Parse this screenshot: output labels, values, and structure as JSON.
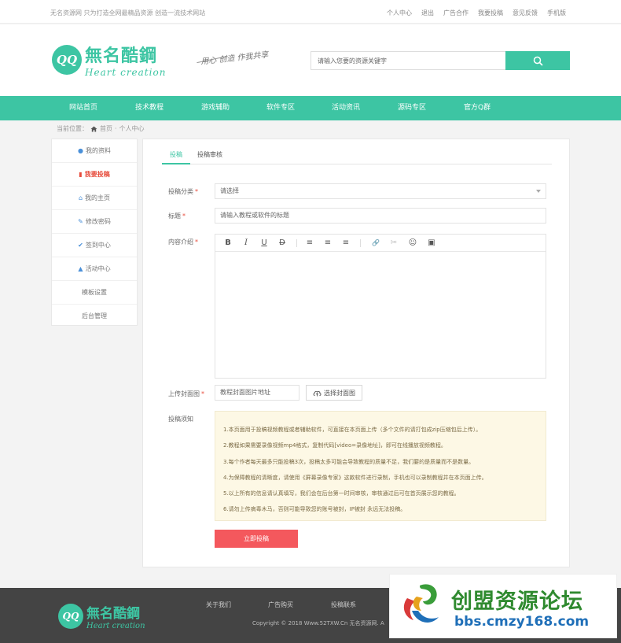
{
  "topbar": {
    "slogan": "无名资源网 只为打造全网最精品资源 创造一流技术网站",
    "links": [
      "个人中心",
      "退出",
      "广告合作",
      "我要投稿",
      "意见反馈",
      "手机版"
    ]
  },
  "header": {
    "logo_mark": "QQ",
    "logo_cn": "無名酷鋼",
    "logo_en": "Heart creation",
    "motto": "用心 创造 作我共享",
    "search_placeholder": "请输入您要的资源关键字"
  },
  "nav": [
    "网站首页",
    "技术教程",
    "游戏辅助",
    "软件专区",
    "活动资讯",
    "源码专区",
    "官方Q群"
  ],
  "breadcrumb": {
    "prefix": "当前位置：",
    "home": "首页",
    "sep": "·",
    "current": "个人中心"
  },
  "sidebar": [
    {
      "icon": "user-icon",
      "label": "我的资料"
    },
    {
      "icon": "file-icon",
      "label": "我要投稿"
    },
    {
      "icon": "home-icon",
      "label": "我的主页"
    },
    {
      "icon": "pencil-icon",
      "label": "修改密码"
    },
    {
      "icon": "signin-icon",
      "label": "签到中心"
    },
    {
      "icon": "fire-icon",
      "label": "活动中心"
    },
    {
      "icon": "",
      "label": "模板设置"
    },
    {
      "icon": "",
      "label": "后台管理"
    }
  ],
  "sidebar_active_index": 1,
  "tabs": [
    "投稿",
    "投稿审核"
  ],
  "form": {
    "category_label": "投稿分类",
    "category_value": "请选择",
    "title_label": "标题",
    "title_placeholder": "请输入教程或软件的标题",
    "content_label": "内容介绍",
    "cover_label": "上传封面图",
    "cover_placeholder": "教程封面图片地址",
    "cover_button": "选择封面图",
    "notice_label": "投稿须知",
    "required_mark": "*",
    "submit": "立即投稿"
  },
  "editor_toolbar": [
    "B",
    "I",
    "U",
    "D",
    "≡",
    "≡",
    "≡",
    "🔗",
    "✂",
    "☺",
    "▣"
  ],
  "notice_lines": [
    "1.本页面用于投稿视频教程或者辅助软件，可直接在本页面上传（多个文件的请打包成zip压缩包后上传）。",
    "2.教程如果需要录像视频mp4格式，复制代码[video=录像地址]，即可在线播放视频教程。",
    "3.每个作者每天最多只能投稿3次，投稿太多可能会导致教程的质量不足，我们要的是质量而不是数量。",
    "4.为保障教程的清晰度，请使用《屏幕录像专家》这款软件进行录制，手机也可以录制教程并在本页面上传。",
    "5.以上所有的信息请认真填写，我们会在后台第一时间审核，审核通过后可在首页展示您的教程。",
    "6.请勿上传病毒木马，否则可能导致您的账号被封，IP被封 永远无法投稿。"
  ],
  "footer": {
    "logo_mark": "QQ",
    "logo_cn": "無名酷鋼",
    "logo_en": "Heart creation",
    "links": [
      "关于我们",
      "广告购买",
      "投稿联系"
    ],
    "copyright": "Copyright © 2018 Www.52TXW.Cn 无名资源网. A"
  },
  "watermark": {
    "cn": "创盟资源论坛",
    "en": "bbs.cmzy168.com"
  },
  "colors": {
    "accent": "#3dc5a3",
    "danger": "#f4585d",
    "notice_bg": "#fdf8e5"
  }
}
